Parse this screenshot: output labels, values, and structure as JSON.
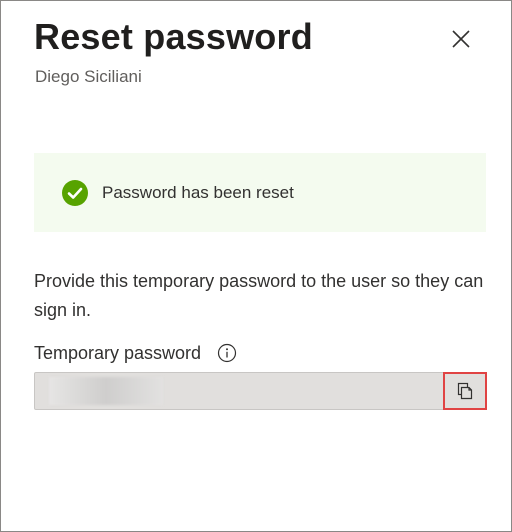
{
  "panel": {
    "title": "Reset password",
    "subtitle": "Diego Siciliani",
    "close_icon": "close-icon"
  },
  "success": {
    "icon": "checkmark-circle-icon",
    "message": "Password has been reset",
    "color": "#57a300"
  },
  "instructions": {
    "text": "Provide this temporary password to the user so they can sign in."
  },
  "password_field": {
    "label": "Temporary password",
    "info_icon": "info-icon",
    "value": "",
    "copy_icon": "copy-icon"
  }
}
